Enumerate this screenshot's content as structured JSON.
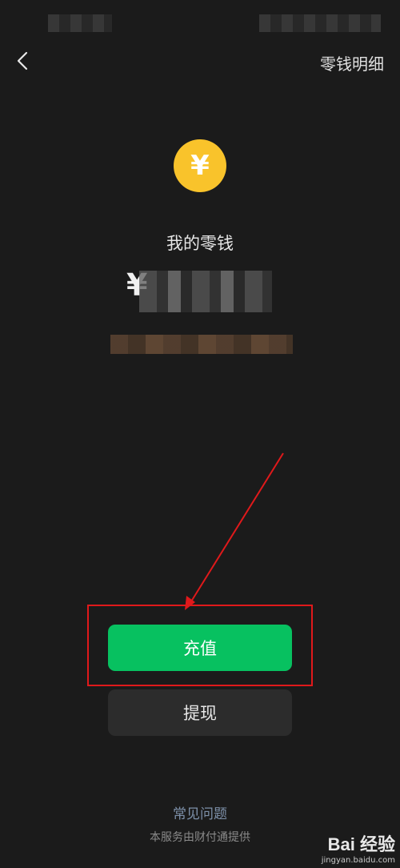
{
  "header": {
    "detail_label": "零钱明细"
  },
  "coin_symbol": "¥",
  "balance": {
    "title": "我的零钱",
    "currency_symbol": "¥"
  },
  "buttons": {
    "recharge_label": "充值",
    "withdraw_label": "提现"
  },
  "footer": {
    "faq_label": "常见问题",
    "service_note": "本服务由财付通提供"
  },
  "watermark": {
    "logo": "Bai 经验",
    "url": "jingyan.baidu.com"
  },
  "colors": {
    "background": "#1b1b1b",
    "primary_green": "#07c160",
    "coin_yellow": "#f9c32b",
    "annotation_red": "#e0191b",
    "link_blue": "#7d90a9"
  },
  "icons": {
    "back": "chevron-left-icon",
    "coin": "yuan-coin-icon"
  }
}
